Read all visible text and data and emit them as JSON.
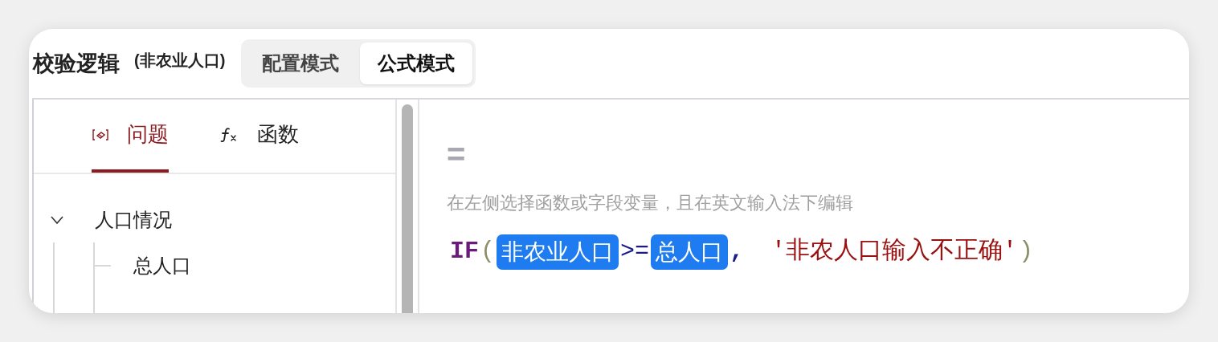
{
  "header": {
    "title": "校验逻辑",
    "subtitle": "(非农业人口)",
    "modes": [
      {
        "label": "配置模式",
        "selected": false
      },
      {
        "label": "公式模式",
        "selected": true
      }
    ]
  },
  "side_tabs": [
    {
      "kind": "question",
      "label": "问题",
      "selected": true
    },
    {
      "kind": "function",
      "label": "函数",
      "selected": false
    }
  ],
  "tree": [
    {
      "label": "人口情况",
      "expanded": true,
      "children": [
        {
          "label": "总人口"
        }
      ]
    }
  ],
  "editor": {
    "equals": "=",
    "hint": "在左侧选择函数或字段变量，且在英文输入法下编辑",
    "tokens": [
      {
        "kind": "function",
        "text": "IF"
      },
      {
        "kind": "paren",
        "text": "("
      },
      {
        "kind": "field",
        "text": "非农业人口"
      },
      {
        "kind": "operator",
        "text": ">="
      },
      {
        "kind": "field",
        "text": "总人口"
      },
      {
        "kind": "comma",
        "text": ","
      },
      {
        "kind": "string",
        "text": "'非农人口输入不正确'"
      },
      {
        "kind": "paren",
        "text": ")"
      }
    ]
  }
}
